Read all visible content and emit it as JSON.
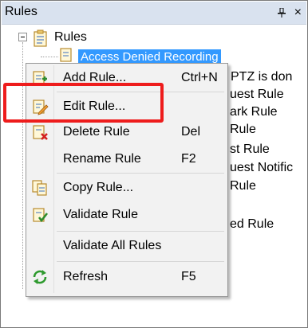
{
  "pane": {
    "title": "Rules",
    "pin_icon": "pin-icon",
    "close_icon": "close-icon"
  },
  "tree": {
    "root_label": "Rules",
    "selected_item_label": "Access Denied Recording"
  },
  "background_fragments": [
    "PTZ is don",
    "uest Rule",
    "ark Rule",
    "Rule",
    "st Rule",
    "uest Notific",
    "Rule",
    "ed Rule"
  ],
  "context_menu": {
    "items": [
      {
        "label": "Add Rule...",
        "shortcut": "Ctrl+N",
        "icon": "add-rule-icon"
      },
      {
        "label": "Edit Rule...",
        "shortcut": "",
        "icon": "edit-rule-icon"
      },
      {
        "label": "Delete Rule",
        "shortcut": "Del",
        "icon": "delete-rule-icon"
      },
      {
        "label": "Rename Rule",
        "shortcut": "F2",
        "icon": ""
      },
      {
        "label": "Copy Rule...",
        "shortcut": "",
        "icon": "copy-rule-icon"
      },
      {
        "label": "Validate Rule",
        "shortcut": "",
        "icon": "validate-rule-icon"
      },
      {
        "label": "Validate All Rules",
        "shortcut": "",
        "icon": ""
      },
      {
        "label": "Refresh",
        "shortcut": "F5",
        "icon": "refresh-icon"
      }
    ]
  },
  "colors": {
    "header_bg": "#d9e2ef",
    "selection": "#3399ff",
    "menu_bg": "#f2f2f2",
    "highlight_box": "#ee1c1c"
  }
}
